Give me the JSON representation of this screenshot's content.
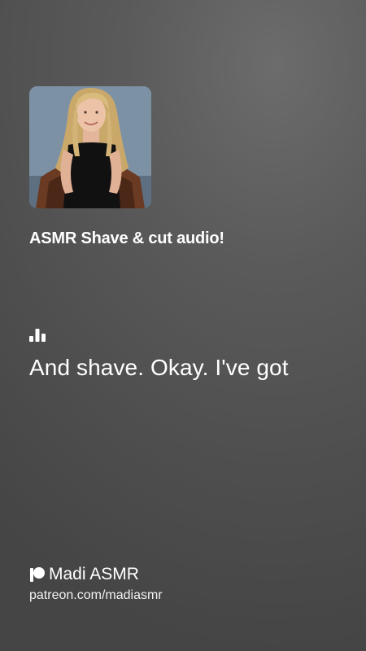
{
  "track": {
    "title": "ASMR Shave & cut audio!"
  },
  "cover": {
    "icon": "creator-photo"
  },
  "player": {
    "wave_icon": "audio-bars-icon",
    "lyric_line": "And shave. Okay. I've got"
  },
  "creator": {
    "icon": "patreon-icon",
    "name": "Madi ASMR",
    "url": "patreon.com/madiasmr"
  },
  "colors": {
    "text": "#ffffff",
    "background": "#555555"
  }
}
